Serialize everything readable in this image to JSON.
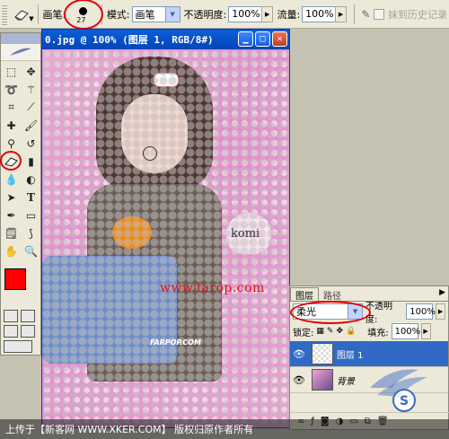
{
  "options_bar": {
    "brush_label": "画笔:",
    "brush_size": "27",
    "mode_label": "模式:",
    "mode_value": "画笔",
    "opacity_label": "不透明度:",
    "opacity_value": "100%",
    "flow_label": "流量:",
    "flow_value": "100%",
    "history_label": "抹到历史记录"
  },
  "document": {
    "title": "0.jpg @ 100% (图层 1, RGB/8#)",
    "overlay_text_komi": "komi",
    "overlay_text_url": "www.farop.com",
    "overlay_text_logo": "FARPOP.COM"
  },
  "layers_panel": {
    "tabs": [
      "图层",
      "路径"
    ],
    "blend_mode": "柔光",
    "opacity_label": "不透明度:",
    "opacity_value": "100%",
    "lock_label": "锁定:",
    "fill_label": "填充:",
    "fill_value": "100%",
    "layers": [
      {
        "name": "图层 1",
        "selected": true
      },
      {
        "name": "背景",
        "selected": false
      }
    ]
  },
  "status": {
    "text": "上传于【新客网 WWW.XKER.COM】 版权归原作者所有"
  },
  "colors": {
    "foreground": "#ff0000",
    "background": "#000000",
    "highlight": "#e00000",
    "title_bar": "#0a5fd8",
    "selected_layer": "#316ac5"
  },
  "icons": [
    "eraser-icon",
    "marquee-icon",
    "move-icon",
    "lasso-icon",
    "magic-wand-icon",
    "crop-icon",
    "slice-icon",
    "healing-icon",
    "brush-icon",
    "clone-stamp-icon",
    "history-brush-icon",
    "eraser-tool-icon",
    "gradient-icon",
    "blur-icon",
    "dodge-icon",
    "path-select-icon",
    "type-icon",
    "pen-icon",
    "shape-icon",
    "notes-icon",
    "eyedropper-icon",
    "hand-icon",
    "zoom-icon",
    "eye-icon"
  ]
}
